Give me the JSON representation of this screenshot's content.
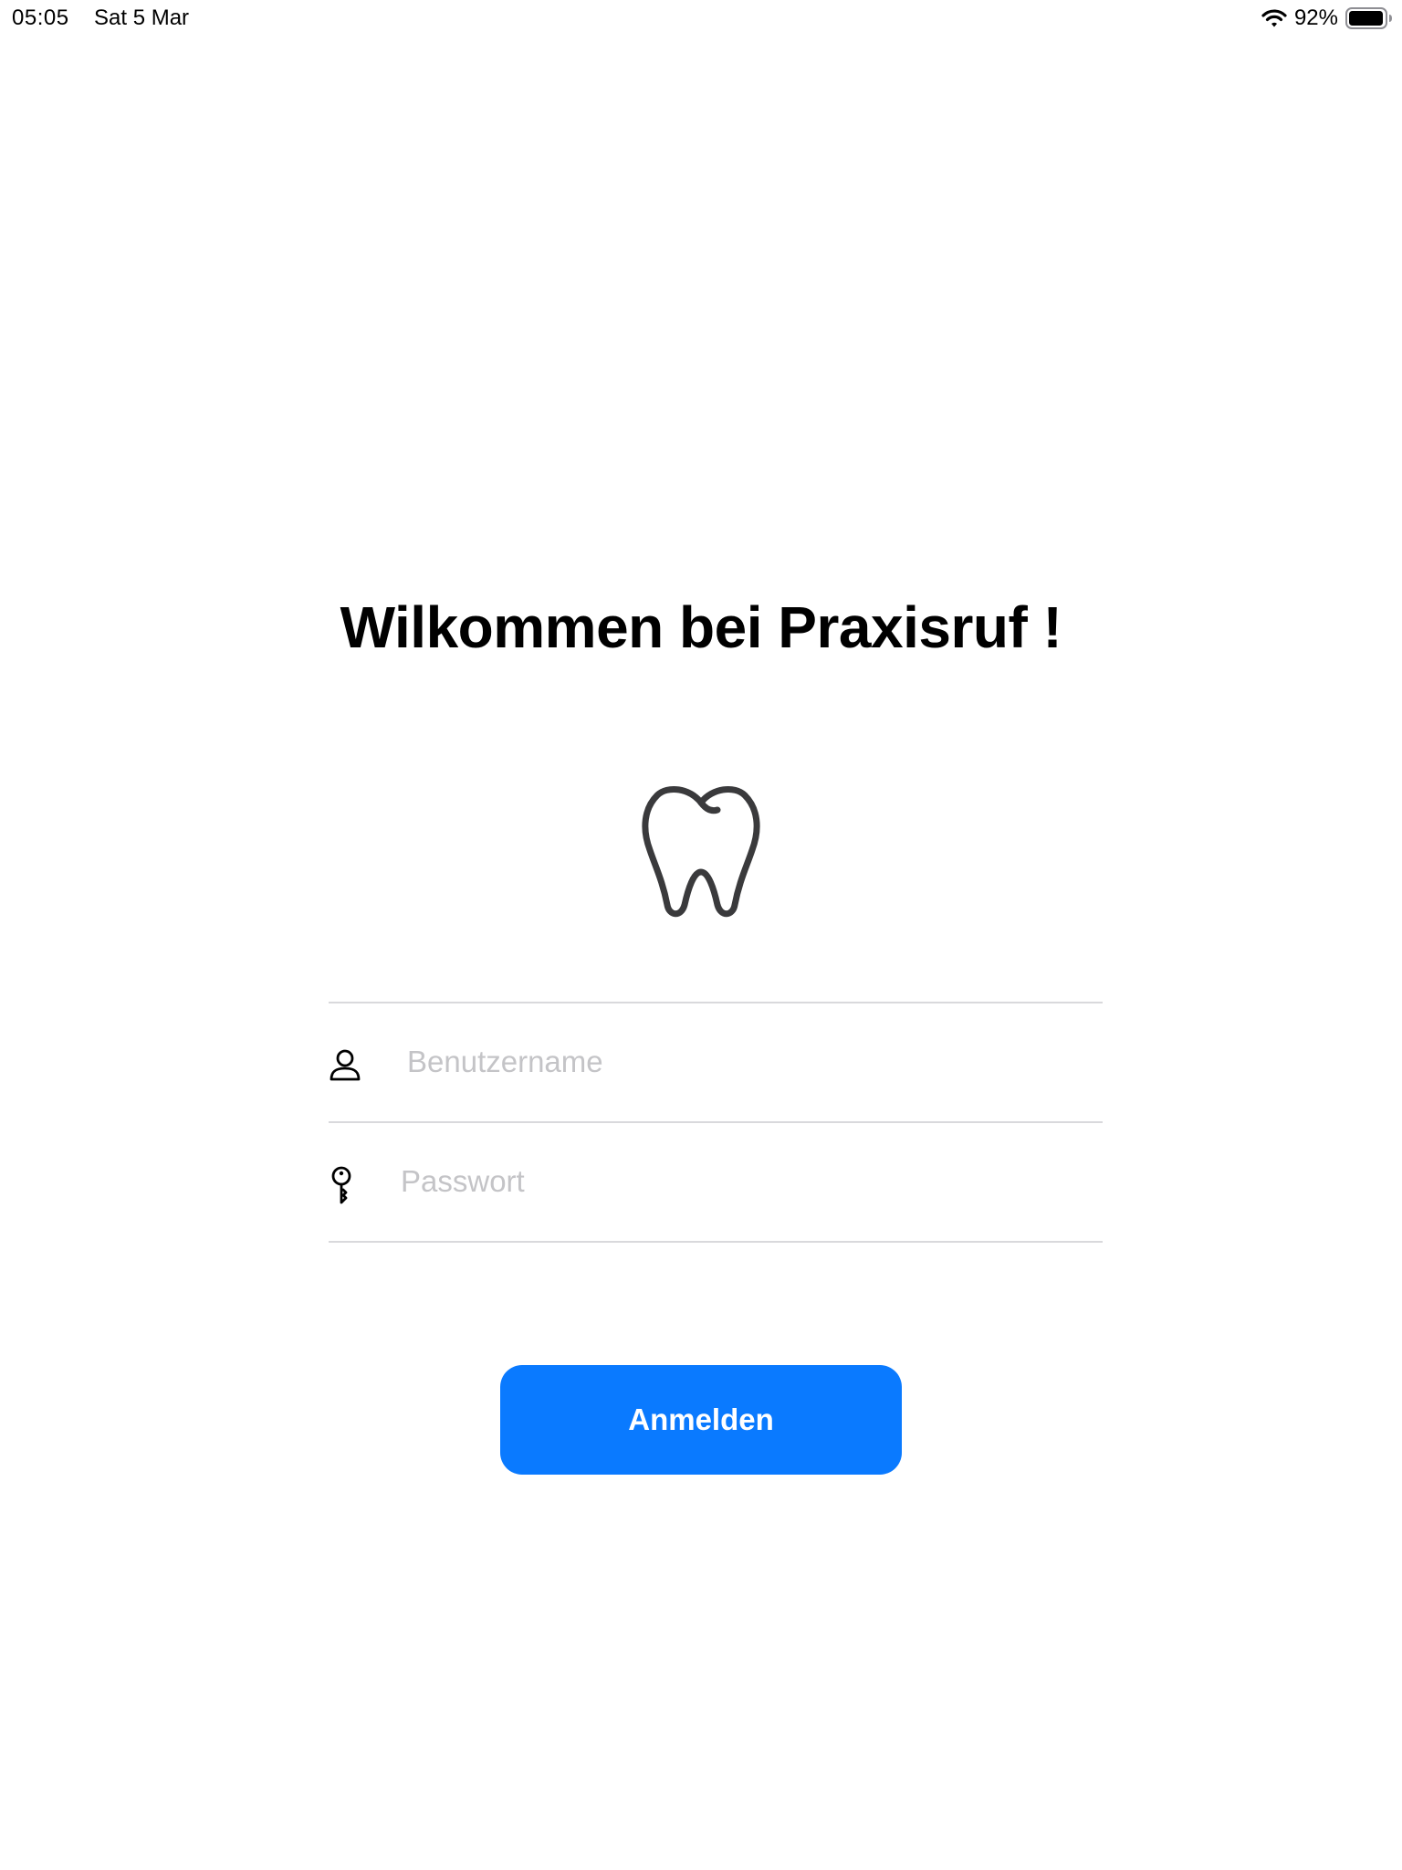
{
  "status_bar": {
    "time": "05:05",
    "date": "Sat 5 Mar",
    "battery_percent": "92%",
    "icons": [
      "wifi-icon",
      "battery-icon"
    ]
  },
  "login": {
    "title": "Wilkommen bei Praxisruf !",
    "logo_icon": "tooth-icon",
    "username": {
      "icon": "person-icon",
      "value": "",
      "placeholder": "Benutzername"
    },
    "password": {
      "icon": "key-icon",
      "value": "",
      "placeholder": "Passwort"
    },
    "submit_label": "Anmelden"
  },
  "colors": {
    "accent": "#0a7aff",
    "divider": "#d9d9dc",
    "placeholder": "#c4c4c7",
    "icon_stroke": "#3a3a3c"
  }
}
